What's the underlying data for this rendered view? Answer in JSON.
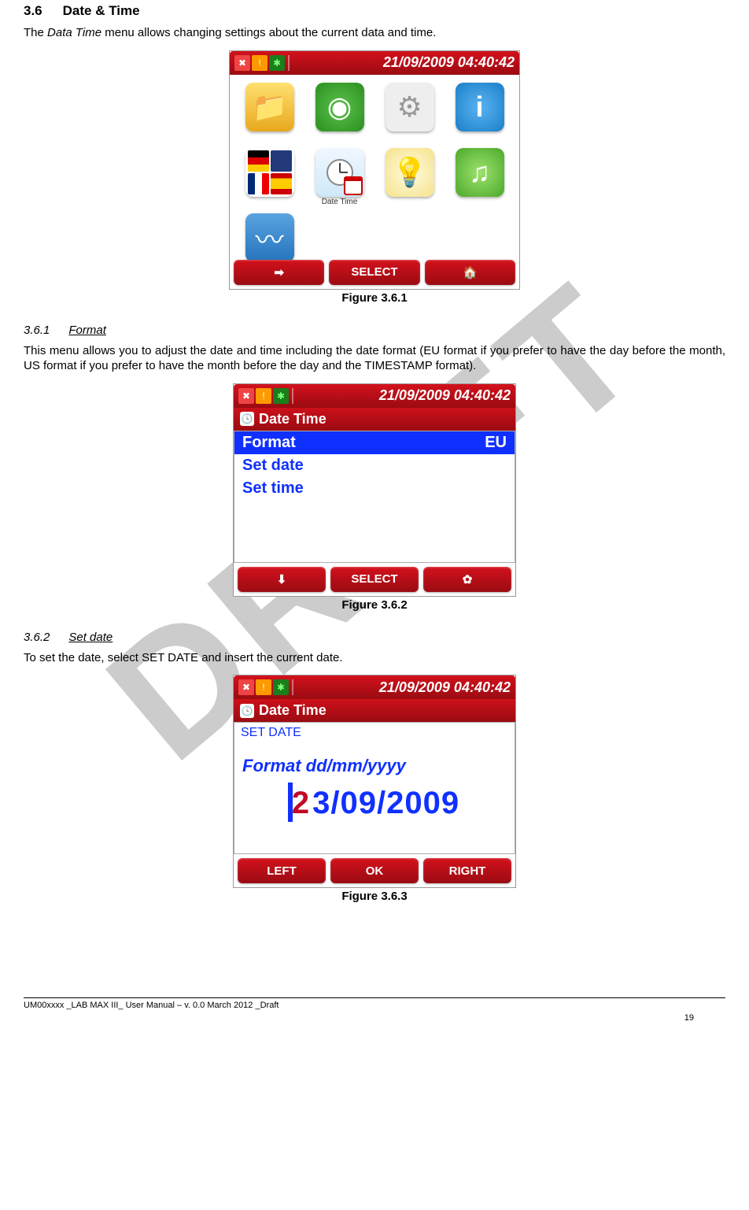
{
  "section": {
    "num": "3.6",
    "title": "Date & Time"
  },
  "intro": {
    "pre": "The ",
    "em": "Data Time",
    "post": " menu allows changing settings about the current data and time."
  },
  "watermark": "DRAFT",
  "topbar_datetime": "21/09/2009 04:40:42",
  "fig1": {
    "caption": "Figure 3.6.1",
    "icons": {
      "datetime_label": "Date Time"
    },
    "buttons": {
      "select": "SELECT"
    }
  },
  "sub1": {
    "num": "3.6.1",
    "title": "Format",
    "text": "This menu allows you to adjust the date and time including the date format (EU format if you prefer to have the day before the month, US format if you prefer to have the month before the day and the TIMESTAMP format)."
  },
  "fig2": {
    "caption": "Figure 3.6.2",
    "screen_title": "Date Time",
    "rows": {
      "format_label": "Format",
      "format_value": "EU",
      "set_date": "Set date",
      "set_time": "Set time"
    },
    "buttons": {
      "select": "SELECT"
    }
  },
  "sub2": {
    "num": "3.6.2",
    "title": "Set date",
    "text": "To set the date, select SET DATE and insert the current date."
  },
  "fig3": {
    "caption": "Figure 3.6.3",
    "screen_title": "Date Time",
    "setdate_label": "SET DATE",
    "format_hint": "Format dd/mm/yyyy",
    "date": {
      "d1": "2",
      "d2": "3",
      "sep1": "/",
      "m": "09",
      "sep2": "/",
      "y": "2009"
    },
    "buttons": {
      "left": "LEFT",
      "ok": "OK",
      "right": "RIGHT"
    }
  },
  "footer": {
    "text": "UM00xxxx _LAB MAX III_ User Manual – v. 0.0 March 2012 _Draft",
    "page": "19"
  }
}
